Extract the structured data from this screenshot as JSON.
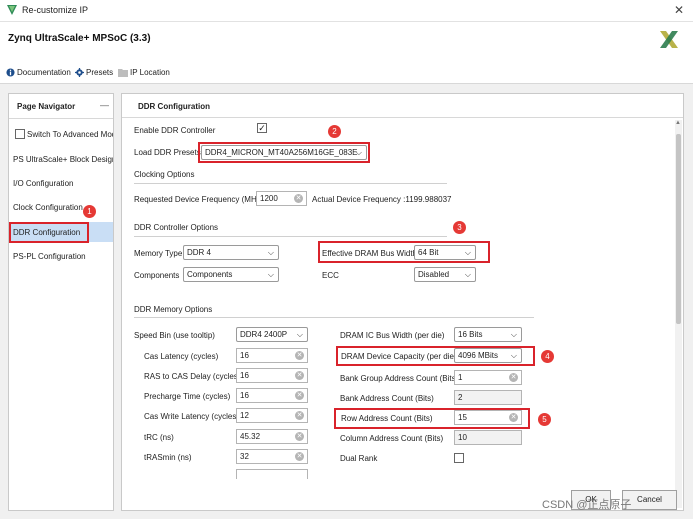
{
  "window": {
    "title": "Re-customize IP",
    "close_glyph": "✕"
  },
  "header": {
    "ip_name": "Zynq UltraScale+ MPSoC (3.3)"
  },
  "links": [
    {
      "label": "Documentation",
      "icon": "info-icon"
    },
    {
      "label": "Presets",
      "icon": "gear-icon"
    },
    {
      "label": "IP Location",
      "icon": "folder-icon"
    }
  ],
  "nav": {
    "title": "Page Navigator",
    "minimize_glyph": "—",
    "advanced_mode_label": "Switch To Advanced Mode",
    "items": [
      {
        "label": "PS UltraScale+ Block Design"
      },
      {
        "label": "I/O Configuration"
      },
      {
        "label": "Clock Configuration"
      },
      {
        "label": "DDR Configuration"
      },
      {
        "label": "PS-PL Configuration"
      }
    ]
  },
  "config": {
    "title": "DDR Configuration",
    "enable_ddr_label": "Enable DDR Controller",
    "enable_ddr_checked": true,
    "load_presets_label": "Load DDR Presets",
    "load_presets_value": "DDR4_MICRON_MT40A256M16GE_083E",
    "clocking": {
      "section": "Clocking Options",
      "req_freq_label": "Requested Device Frequency (MHz)",
      "req_freq_value": "1200",
      "actual_freq_text": "Actual Device Frequency :1199.988037"
    },
    "controller": {
      "section": "DDR Controller Options",
      "memory_type_label": "Memory Type",
      "memory_type_value": "DDR 4",
      "components_label": "Components",
      "components_value": "Components",
      "bus_width_label": "Effective DRAM Bus Width",
      "bus_width_value": "64 Bit",
      "ecc_label": "ECC",
      "ecc_value": "Disabled"
    },
    "memory": {
      "section": "DDR Memory Options",
      "speed_bin_label": "Speed Bin (use tooltip)",
      "speed_bin_value": "DDR4 2400P",
      "left_fields": [
        {
          "label": "Cas Latency (cycles)",
          "value": "16"
        },
        {
          "label": "RAS to CAS Delay (cycles)",
          "value": "16"
        },
        {
          "label": "Precharge Time (cycles)",
          "value": "16"
        },
        {
          "label": "Cas Write Latency (cycles)",
          "value": "12"
        },
        {
          "label": "tRC (ns)",
          "value": "45.32"
        },
        {
          "label": "tRASmin (ns)",
          "value": "32"
        }
      ],
      "ic_bus_width_label": "DRAM IC Bus Width (per die)",
      "ic_bus_width_value": "16 Bits",
      "device_capacity_label": "DRAM Device Capacity (per die)",
      "device_capacity_value": "4096 MBits",
      "bank_group_label": "Bank Group Address Count (Bits)",
      "bank_group_value": "1",
      "bank_addr_label": "Bank Address Count (Bits)",
      "bank_addr_value": "2",
      "row_addr_label": "Row Address Count (Bits)",
      "row_addr_value": "15",
      "col_addr_label": "Column Address Count (Bits)",
      "col_addr_value": "10",
      "dual_rank_label": "Dual Rank",
      "dual_rank_checked": false
    }
  },
  "annotations": [
    "1",
    "2",
    "3",
    "4",
    "5"
  ],
  "buttons": {
    "ok": "OK",
    "cancel": "Cancel"
  },
  "watermark": "CSDN @正点原子",
  "colors": {
    "highlight": "#d9232b",
    "badge": "#e53935",
    "nav_selected": "#c9def5"
  }
}
